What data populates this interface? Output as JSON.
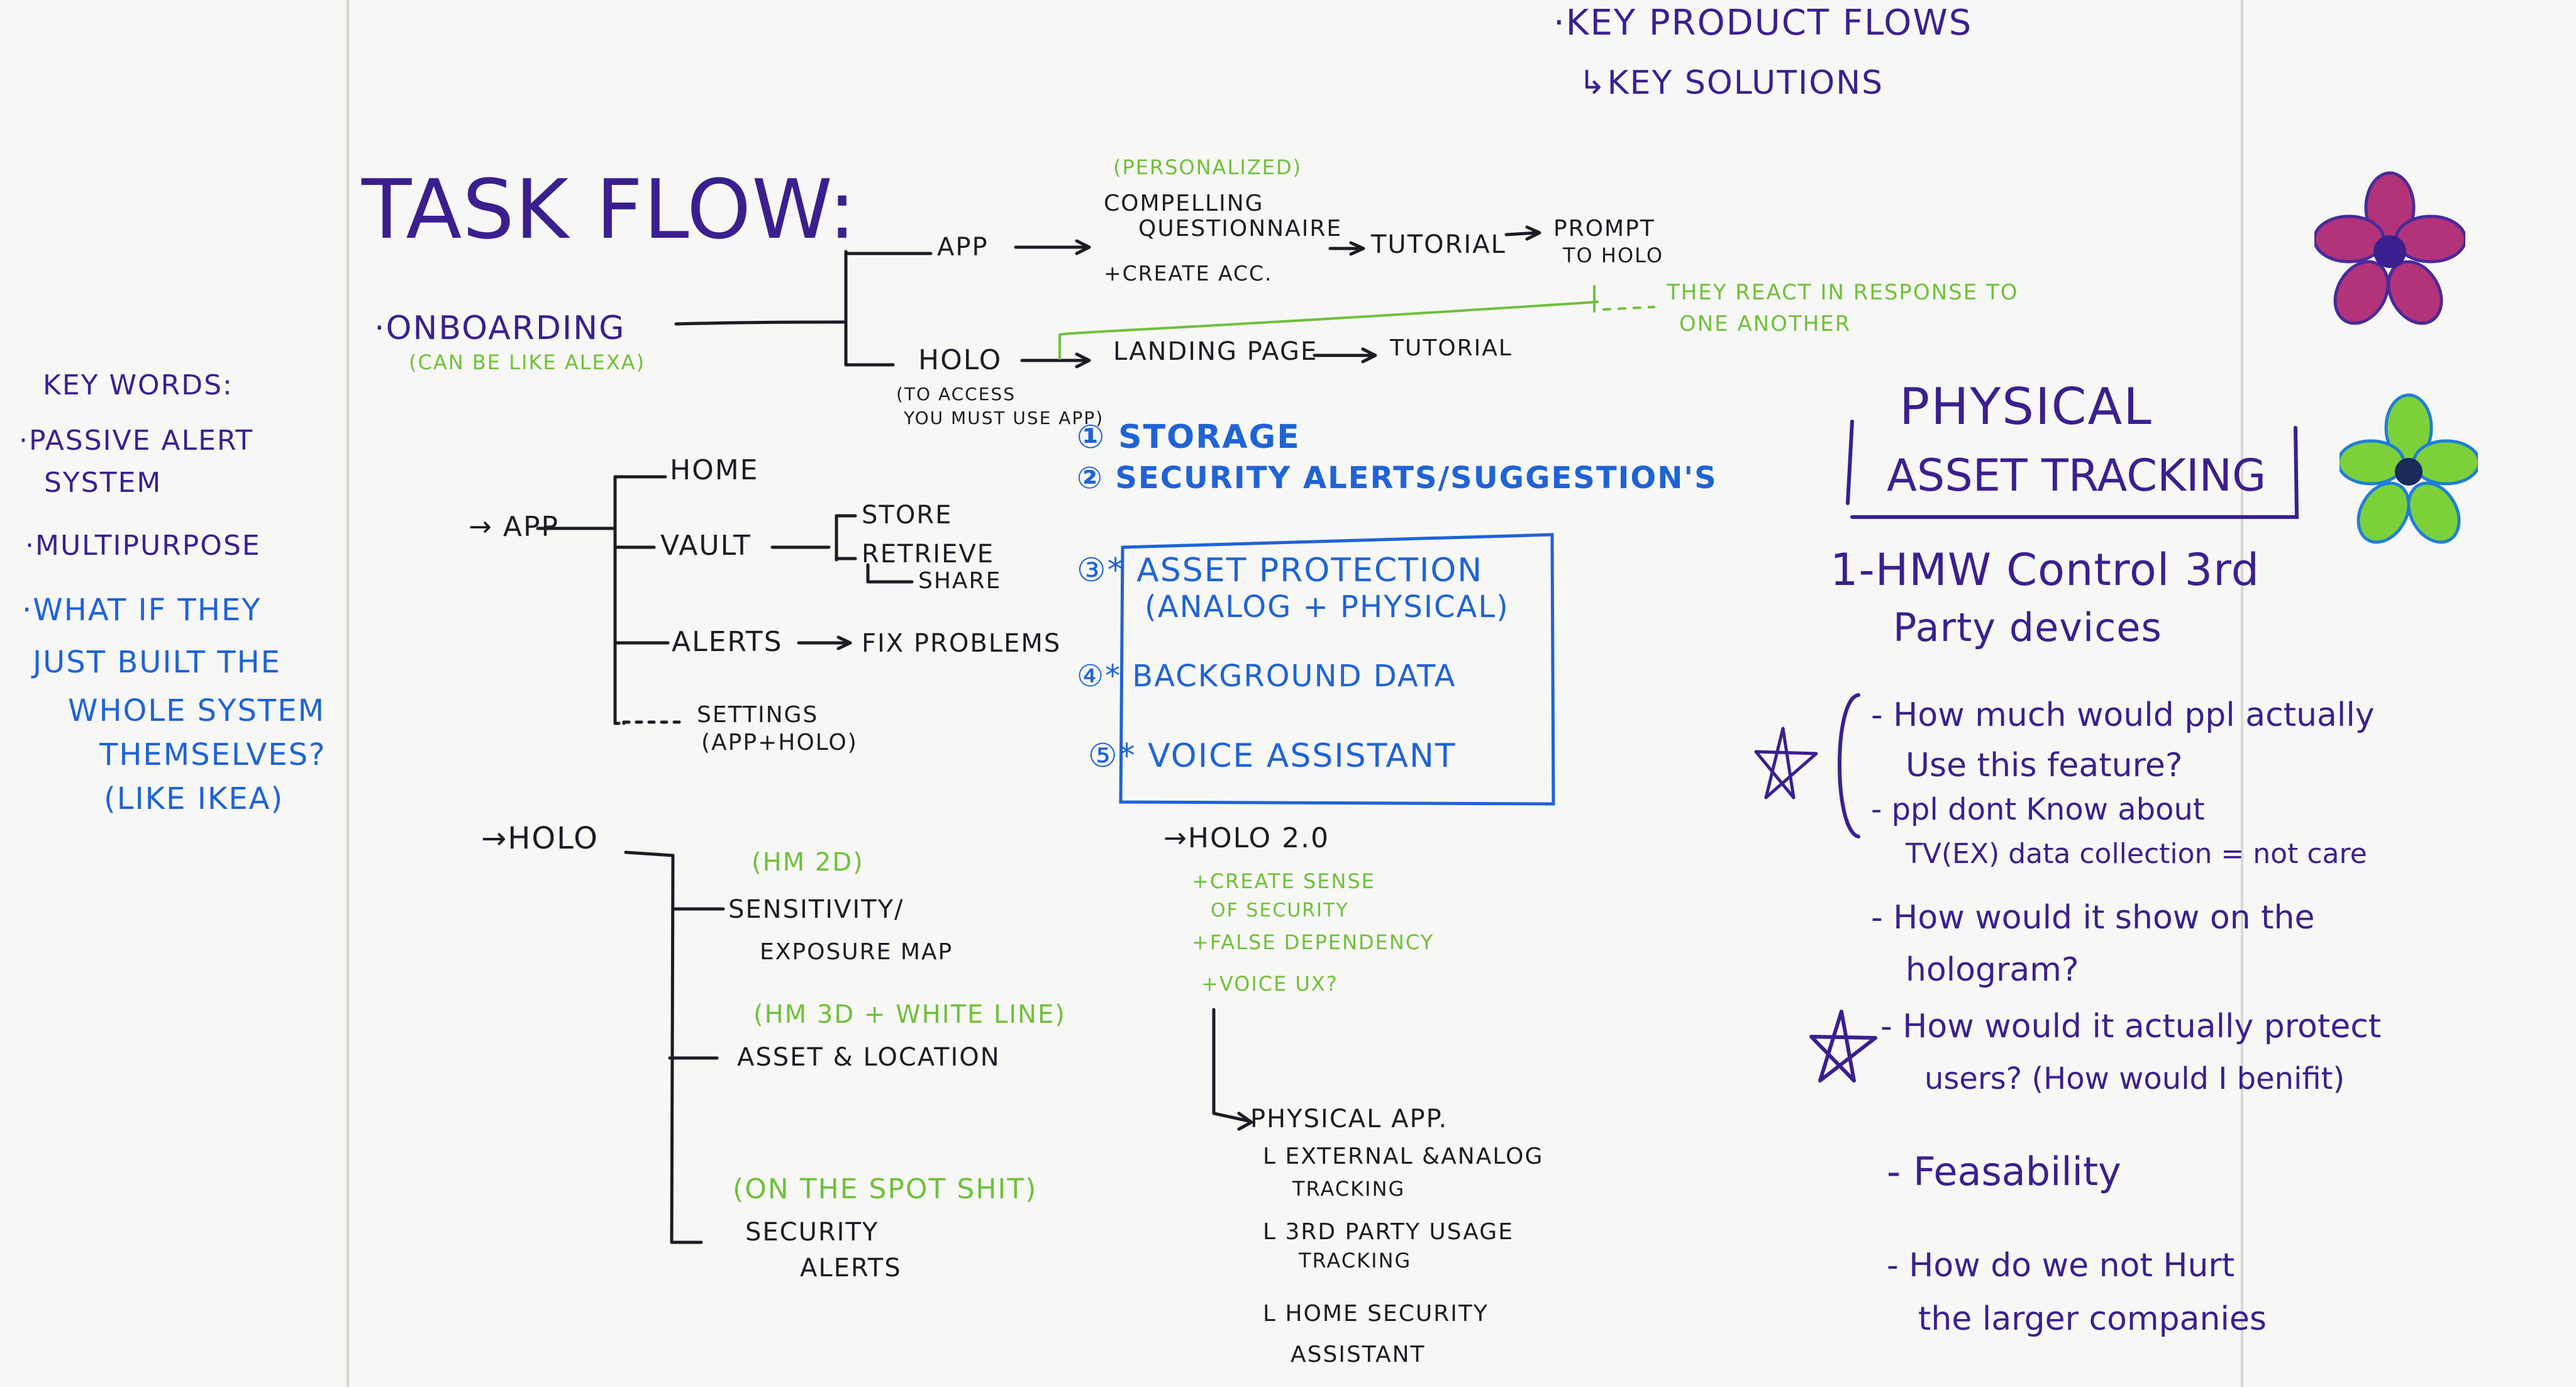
{
  "header": {
    "line1": "·KEY PRODUCT FLOWS",
    "line2": "↳KEY SOLUTIONS"
  },
  "task_flow": {
    "title": "TASK FLOW:",
    "onboarding": {
      "label": "·ONBOARDING",
      "note": "(CAN BE LIKE ALEXA)",
      "app_label": "APP",
      "personalized": "(PERSONALIZED)",
      "compelling": "COMPELLING",
      "questionnaire": "QUESTIONNAIRE",
      "create_acc": "+CREATE ACC.",
      "tutorial_app": "TUTORIAL",
      "prompt": "PROMPT",
      "to_holo": "TO HOLO",
      "holo_label": "HOLO",
      "to_access": "(TO ACCESS",
      "must_use_app": "YOU MUST USE APP)",
      "landing_page": "LANDING PAGE",
      "tutorial_holo": "TUTORIAL",
      "react_1": "THEY REACT IN RESPONSE TO",
      "react_2": "ONE ANOTHER"
    },
    "app_tree": {
      "label": "APP",
      "home": "HOME",
      "vault": "VAULT",
      "store": "STORE",
      "retrieve": "RETRIEVE",
      "share": "SHARE",
      "alerts": "ALERTS",
      "fix_problems": "FIX PROBLEMS",
      "settings": "SETTINGS",
      "settings_note": "(APP+HOLO)"
    },
    "numbered": [
      "① STORAGE",
      "② SECURITY ALERTS/SUGGESTION'S",
      "③* ASSET PROTECTION",
      "(ANALOG + PHYSICAL)",
      "④* BACKGROUND DATA",
      "⑤* VOICE ASSISTANT"
    ],
    "holo_tree": {
      "label": "HOLO",
      "hm2d": "(HM 2D)",
      "sensitivity": "SENSITIVITY/",
      "exposure_map": "EXPOSURE MAP",
      "hm3d": "(HM 3D + WHITE LINE)",
      "asset_location": "ASSET & LOCATION",
      "spot": "(ON THE SPOT SHIT)",
      "security": "SECURITY",
      "alerts": "ALERTS"
    },
    "holo2": {
      "label": "HOLO 2.0",
      "create_sense": "+CREATE SENSE",
      "of_security": "OF SECURITY",
      "false_dependency": "+FALSE DEPENDENCY",
      "voice_ux": "+VOICE UX?",
      "physical_app": "PHYSICAL APP.",
      "external": "L EXTERNAL &ANALOG",
      "tracking1": "TRACKING",
      "third_party": "L 3RD PARTY USAGE",
      "tracking2": "TRACKING",
      "home_security": "L HOME SECURITY",
      "assistant": "ASSISTANT"
    }
  },
  "key_words": {
    "title": "KEY WORDS:",
    "passive_1": "·PASSIVE ALERT",
    "passive_2": "SYSTEM",
    "multipurpose": "·MULTIPURPOSE",
    "whatif_1": "·WHAT IF THEY",
    "whatif_2": "JUST BUILT THE",
    "whatif_3": "WHOLE SYSTEM",
    "whatif_4": "THEMSELVES?",
    "whatif_5": "(LIKE IKEA)"
  },
  "physical": {
    "title_1": "PHYSICAL",
    "title_2": "ASSET TRACKING",
    "hmw_1": "1-HMW Control 3rd",
    "hmw_2": "Party devices",
    "q1_1": "- How much would ppl actually",
    "q1_2": "Use this feature?",
    "q2_1": "- ppl dont Know about",
    "q2_2": "TV(EX) data collection = not care",
    "q3_1": "- How would it show on the",
    "q3_2": "hologram?",
    "q4_1": "- How would it actually protect",
    "q4_2": "users? (How would I benifit)",
    "q5": "- Feasability",
    "q6_1": "- How do we not Hurt",
    "q6_2": "the larger companies"
  },
  "colors": {
    "black": "#1d1b24",
    "purple": "#3b1f8f",
    "blue": "#1f63d6",
    "green": "#6fc03a",
    "flower_magenta": "#b2337a",
    "flower_green": "#7cd13b"
  },
  "icons": [
    "star-icon",
    "magenta-flower-icon",
    "green-flower-icon"
  ]
}
